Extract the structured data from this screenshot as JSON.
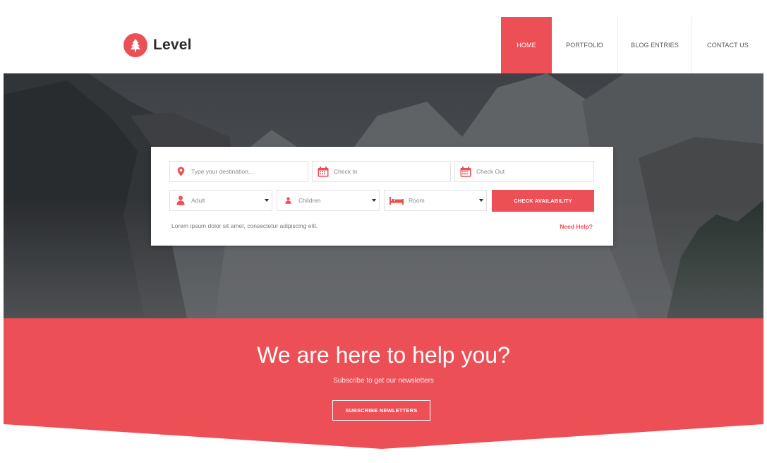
{
  "brand": {
    "name": "Level",
    "icon": "tree-icon",
    "accent_color": "#ec4f56"
  },
  "nav": {
    "items": [
      {
        "label": "HOME",
        "active": true
      },
      {
        "label": "PORTFOLIO",
        "active": false
      },
      {
        "label": "BLOG ENTRIES",
        "active": false
      },
      {
        "label": "CONTACT US",
        "active": false
      }
    ]
  },
  "booking": {
    "destination": {
      "placeholder": "Type your destination...",
      "icon": "map-pin-icon"
    },
    "check_in": {
      "placeholder": "Check In",
      "icon": "calendar-icon"
    },
    "check_out": {
      "placeholder": "Check Out",
      "icon": "calendar-icon"
    },
    "adult": {
      "value": "Adult",
      "icon": "person-icon"
    },
    "children": {
      "value": "Children",
      "icon": "child-icon"
    },
    "room": {
      "value": "Room",
      "icon": "bed-icon"
    },
    "button_label": "CHECK AVAILABILITY",
    "note": "Lorem ipsum dolor sit amet, consectetur adipiscing elit.",
    "help_link": "Need Help?"
  },
  "newsletter": {
    "title": "We are here to help you?",
    "subtitle": "Subscribe to get our newsletters",
    "button_label": "SUBSCRIBE NEWLETTERS"
  }
}
